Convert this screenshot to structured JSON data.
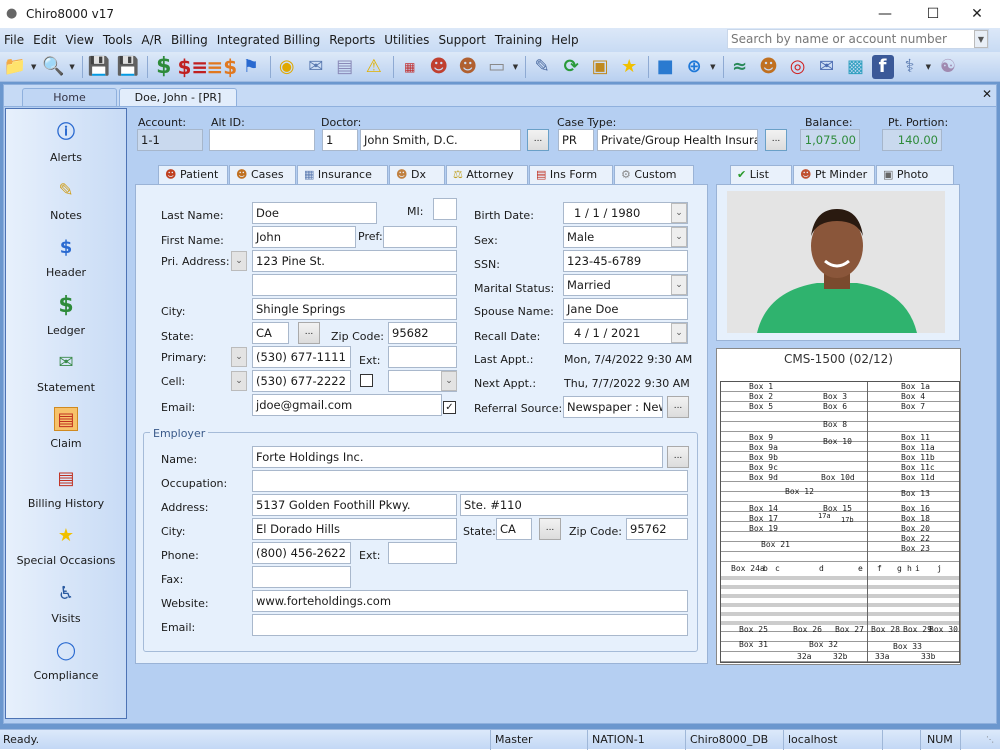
{
  "window": {
    "title": "Chiro8000 v17",
    "controls": [
      "minimize",
      "maximize",
      "close"
    ]
  },
  "menu": [
    "File",
    "Edit",
    "View",
    "Tools",
    "A/R",
    "Billing",
    "Integrated Billing",
    "Reports",
    "Utilities",
    "Support",
    "Training",
    "Help"
  ],
  "search": {
    "placeholder": "Search by name or account number"
  },
  "toolbar_icons": [
    "new-folder-icon",
    "open-search-icon",
    "save-check-icon",
    "save-icon",
    "dollar-icon",
    "dollar-statement-icon",
    "dollar-list-icon",
    "flag-icon",
    "coin-icon",
    "mail-server-icon",
    "cabinet-icon",
    "warning-icon",
    "calendar-icon",
    "user-remove-icon",
    "user-card-icon",
    "scanner-icon",
    "signature-icon",
    "refresh-icon",
    "package-check-icon",
    "star-icon",
    "blocks-icon",
    "add-network-icon",
    "chart-icon",
    "users-icon",
    "target-icon",
    "email-icon",
    "photo-icon",
    "facebook-icon",
    "emr-icon",
    "database-icon"
  ],
  "doc_tabs": [
    {
      "label": "Home"
    },
    {
      "label": "Doe, John - [PR]",
      "active": true
    }
  ],
  "sidebar": {
    "items": [
      {
        "label": "Alerts",
        "icon": "info-icon"
      },
      {
        "label": "Notes",
        "icon": "notes-icon"
      },
      {
        "label": "Header",
        "icon": "header-icon"
      },
      {
        "label": "Ledger",
        "icon": "dollar-icon"
      },
      {
        "label": "Statement",
        "icon": "statement-icon"
      },
      {
        "label": "Claim",
        "icon": "claim-icon",
        "selected": true
      },
      {
        "label": "Billing History",
        "icon": "billing-history-icon"
      },
      {
        "label": "Special Occasions",
        "icon": "star-icon"
      },
      {
        "label": "Visits",
        "icon": "visits-icon"
      },
      {
        "label": "Compliance",
        "icon": "compliance-icon"
      }
    ]
  },
  "header": {
    "account_label": "Account:",
    "account": "1-1",
    "alt_id_label": "Alt ID:",
    "alt_id": "",
    "doctor_label": "Doctor:",
    "doctor_id": "1",
    "doctor_name": "John Smith, D.C.",
    "case_type_label": "Case Type:",
    "case_type_code": "PR",
    "case_type_name": "Private/Group Health Insuranc",
    "balance_label": "Balance:",
    "balance": "1,075.00",
    "pt_portion_label": "Pt. Portion:",
    "pt_portion": "140.00",
    "ellipsis": "..."
  },
  "patient_tabs": [
    "Patient",
    "Cases",
    "Insurance",
    "Dx",
    "Attorney",
    "Ins Form",
    "Custom"
  ],
  "right_tabs": [
    "List",
    "Pt Minder",
    "Photo"
  ],
  "patient": {
    "last_name_label": "Last Name:",
    "last_name": "Doe",
    "mi_label": "MI:",
    "mi": "",
    "first_name_label": "First Name:",
    "first_name": "John",
    "pref_label": "Pref:",
    "pref": "",
    "address_label": "Pri. Address:",
    "address1": "123 Pine St.",
    "address2": "",
    "city_label": "City:",
    "city": "Shingle Springs",
    "state_label": "State:",
    "state": "CA",
    "zip_label": "Zip Code:",
    "zip": "95682",
    "primary_label": "Primary:",
    "primary": "(530) 677-1111",
    "ext_label": "Ext:",
    "ext": "",
    "cell_label": "Cell:",
    "cell": "(530) 677-2222",
    "cell_checked": false,
    "cell_carrier": "",
    "email_label": "Email:",
    "email": "jdoe@gmail.com",
    "email_checked": true,
    "birth_label": "Birth Date:",
    "birth": "1 /  1 / 1980",
    "sex_label": "Sex:",
    "sex": "Male",
    "ssn_label": "SSN:",
    "ssn": "123-45-6789",
    "marital_label": "Marital Status:",
    "marital": "Married",
    "spouse_label": "Spouse Name:",
    "spouse": "Jane Doe",
    "recall_label": "Recall Date:",
    "recall": "4 /  1 / 2021",
    "last_appt_label": "Last Appt.:",
    "last_appt": "Mon, 7/4/2022 9:30 AM",
    "next_appt_label": "Next Appt.:",
    "next_appt": "Thu, 7/7/2022 9:30 AM",
    "referral_label": "Referral Source:",
    "referral": "Newspaper : Newsp"
  },
  "employer": {
    "group_label": "Employer",
    "name_label": "Name:",
    "name": "Forte Holdings Inc.",
    "occupation_label": "Occupation:",
    "occupation": "",
    "address_label": "Address:",
    "address1": "5137 Golden Foothill Pkwy.",
    "address2": "Ste. #110",
    "city_label": "City:",
    "city": "El Dorado Hills",
    "state_label": "State:",
    "state": "CA",
    "zip_label": "Zip Code:",
    "zip": "95762",
    "phone_label": "Phone:",
    "phone": "(800) 456-2622",
    "ext_label": "Ext:",
    "ext": "",
    "fax_label": "Fax:",
    "fax": "",
    "website_label": "Website:",
    "website": "www.forteholdings.com",
    "email_label": "Email:",
    "email": ""
  },
  "cms": {
    "title": "CMS-1500 (02/12)",
    "boxes": [
      "Box 1",
      "Box 1a",
      "Box 2",
      "Box 3",
      "Box 4",
      "Box 5",
      "Box 6",
      "Box 7",
      "Box 8",
      "Box 9",
      "Box 10",
      "Box 11",
      "Box 9a",
      "Box 11a",
      "Box 9b",
      "Box 11b",
      "Box 9c",
      "Box 11c",
      "Box 9d",
      "Box 10d",
      "Box 11d",
      "Box 12",
      "Box 13",
      "Box 14",
      "Box 15",
      "Box 16",
      "Box 17",
      "17a",
      "17b",
      "Box 18",
      "Box 19",
      "Box 20",
      "Box 21",
      "Box 22",
      "Box 23",
      "Box 24a",
      "b",
      "c",
      "d",
      "e",
      "f",
      "g",
      "h",
      "i",
      "j",
      "Box 25",
      "Box 26",
      "Box 27",
      "Box 28",
      "Box 29",
      "Box 30",
      "Box 31",
      "Box 32",
      "Box 33",
      "32a",
      "32b",
      "33a",
      "33b"
    ]
  },
  "status": {
    "text": "Ready.",
    "user": "Master",
    "machine": "NATION-1",
    "database": "Chiro8000_DB",
    "server": "localhost",
    "num": "NUM"
  },
  "colors": {
    "accent": "#6b97ce",
    "money": "#2e8b3a"
  }
}
